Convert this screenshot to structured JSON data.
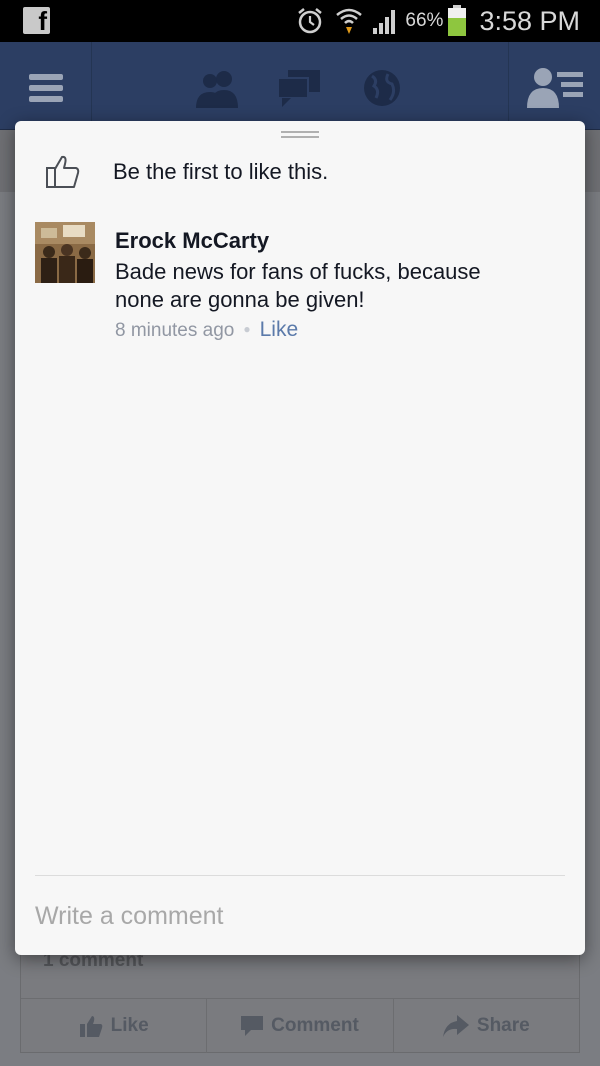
{
  "status_bar": {
    "battery_percent": "66%",
    "time": "3:58 PM",
    "app_icon": "facebook-notification-icon",
    "icons": [
      "alarm-icon",
      "wifi-icon",
      "signal-icon",
      "battery-icon"
    ],
    "battery_level": 0.66,
    "battery_color": "#8ec63f"
  },
  "nav": {
    "icons": [
      "menu-icon",
      "friend-requests-icon",
      "messages-icon",
      "notifications-globe-icon",
      "friends-list-icon"
    ]
  },
  "background_post": {
    "comment_count": "1 comment",
    "actions": {
      "like": "Like",
      "comment": "Comment",
      "share": "Share"
    }
  },
  "popup": {
    "like_prompt": "Be the first to like this.",
    "comments": [
      {
        "author": "Erock McCarty",
        "text": "Bade news for fans of fucks, because none are gonna be given!",
        "time": "8 minutes ago",
        "like_label": "Like"
      }
    ],
    "write_placeholder": "Write a comment"
  },
  "colors": {
    "nav_bg": "#2c3e63",
    "popup_bg": "#f7f7f7",
    "link": "#5b7aaa",
    "meta_text": "#9197a3"
  }
}
